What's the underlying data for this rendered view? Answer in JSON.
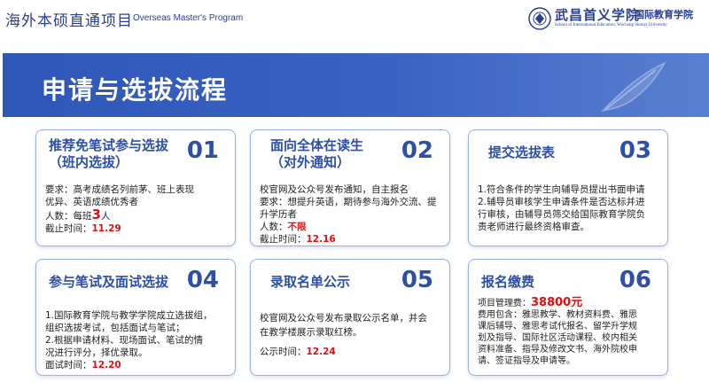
{
  "header": {
    "title": "海外本硕直通项目",
    "subtitle": "Overseas Master's Program",
    "logo_cn": "武昌首义学院",
    "logo_cn2": "国际教育学院",
    "logo_en": "School of International Education, Wuchang Shouyi University"
  },
  "banner": {
    "title": "申请与选拔流程"
  },
  "cards": [
    {
      "num": "01",
      "title1": "推荐免笔试参与选拔",
      "title2": "（班内选拔）",
      "lines": [
        "要求：高考成绩名列前茅、班上表现",
        "优异、英语成绩优秀者"
      ],
      "count_label": "人数：每班",
      "count_value": "3",
      "count_unit": "人",
      "deadline_label": "截止时间：",
      "deadline_value": "11.29"
    },
    {
      "num": "02",
      "title1": "面向全体在读生",
      "title2": "（对外通知）",
      "lines": [
        "校官网及公众号发布通知，自主报名",
        "要求：想提升英语，期待参与海外交流、提",
        "升学历者"
      ],
      "count_label": "人数：",
      "count_value": "不限",
      "deadline_label": "截止时间：",
      "deadline_value": "12.16"
    },
    {
      "num": "03",
      "title1": "提交选拔表",
      "lines": [
        "1.符合条件的学生向辅导员提出书面申请",
        "2.辅导员审核学生申请条件是否达标并进",
        "行审核，由辅导员筛交给国际教育学院负",
        "责老师进行最终资格审查。"
      ]
    },
    {
      "num": "04",
      "title1": "参与笔试及面试选拔",
      "lines": [
        "1.国际教育学院与教学学院成立选拔组，",
        "组织选拔考试，包括面试与笔试；",
        "2.根据申请材料、现场面试、笔试的情",
        "况进行评分，择优录取。"
      ],
      "deadline_label": "面试时间：",
      "deadline_value": "12.20"
    },
    {
      "num": "05",
      "title1": "录取名单公示",
      "lines": [
        "校官网及公众号发布录取公示名单，并会",
        "在教学楼展示录取红榜。"
      ],
      "deadline_label": "公示时间：",
      "deadline_value": "12.24"
    },
    {
      "num": "06",
      "title1": "报名缴费",
      "fee_label": "项目管理费：",
      "fee_value": "38800元",
      "lines": [
        "费用包含：雅思教学、教材资料费、雅思",
        "课后辅导、雅思考试代报名、留学升学规",
        "划及指导、国际社区活动课程、校内相关",
        "资料准备、指导及修改文书、海外院校申",
        "请、签证指导及申请等。"
      ]
    }
  ],
  "colors": {
    "primary": "#2c4fa8",
    "accent_red": "#e01010",
    "banner": "#3a62c2"
  }
}
